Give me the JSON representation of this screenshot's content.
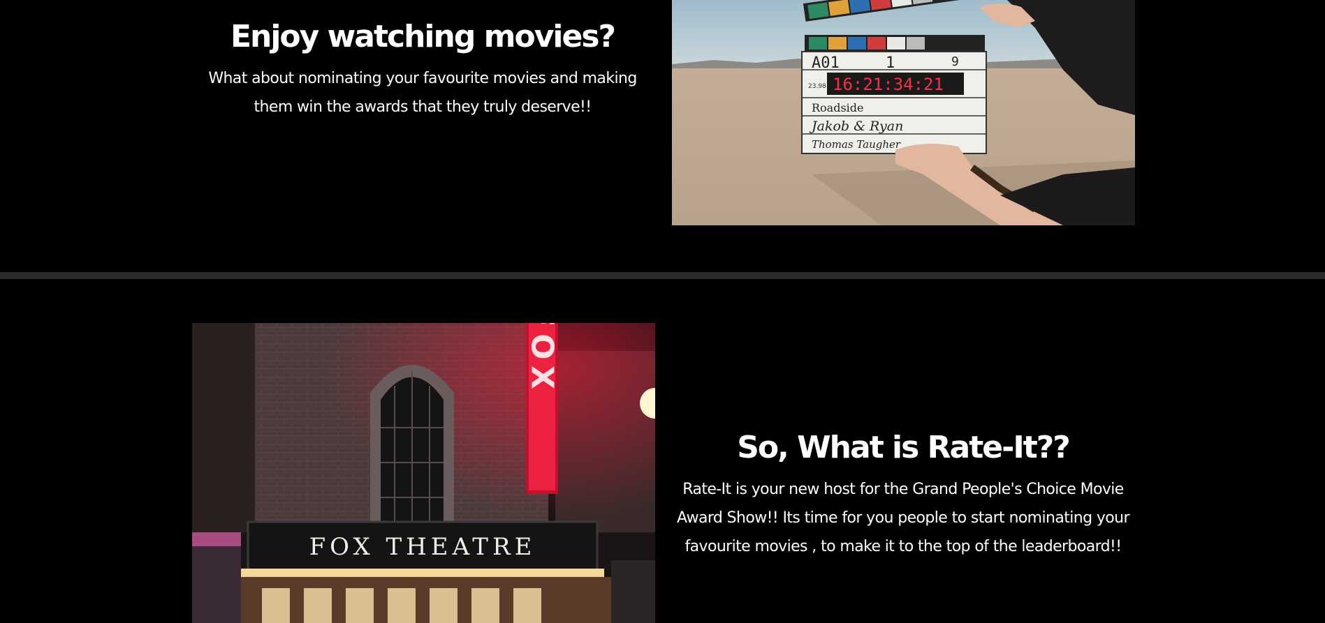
{
  "section_one": {
    "heading": "Enjoy watching movies?",
    "body": "What about nominating your favourite movies and making them win the awards that they truly deserve!!",
    "image": {
      "clapper_fields": {
        "roll": "A01",
        "scene": "1",
        "take": "9",
        "fps": "23.98",
        "timecode": "16:21:34:21",
        "production": "Roadside",
        "director": "Jakob & Ryan",
        "camera": "Thomas Taugher"
      }
    }
  },
  "section_two": {
    "heading": "So, What is Rate-It??",
    "body": "Rate-It is your new host for the Grand People's Choice Movie Award Show!! Its time for you people to start nominating your favourite movies , to make it to the top of the leaderboard!!",
    "image": {
      "marquee_text": "FOX THEATRE",
      "vertical_sign": "FOX"
    }
  },
  "colors": {
    "background": "#000000",
    "divider": "#2b2b2b",
    "text": "#ffffff",
    "neon_red": "#ff1a3c"
  }
}
